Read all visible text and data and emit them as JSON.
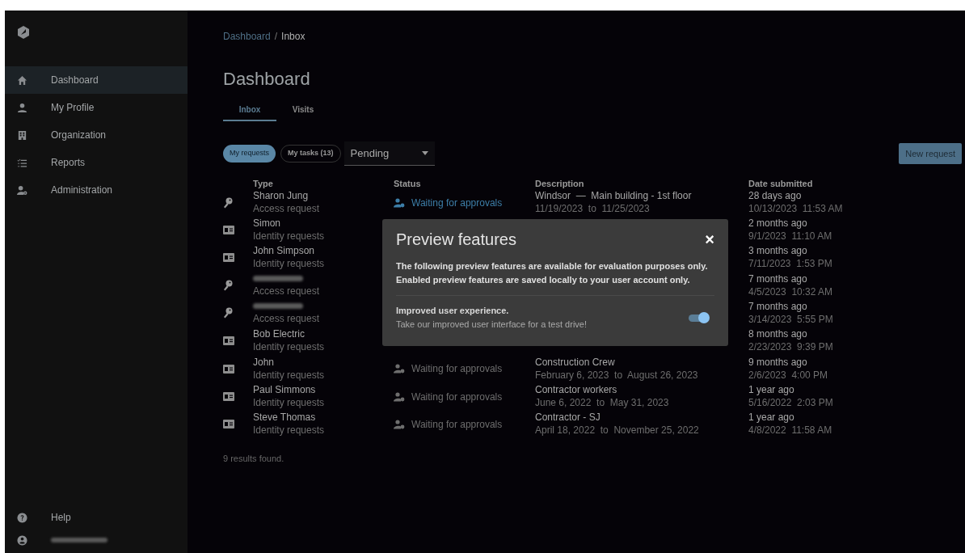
{
  "sidebar": {
    "items": [
      {
        "label": "Dashboard",
        "selected": true
      },
      {
        "label": "My Profile",
        "selected": false
      },
      {
        "label": "Organization",
        "selected": false
      },
      {
        "label": "Reports",
        "selected": false
      },
      {
        "label": "Administration",
        "selected": false
      }
    ],
    "bottom_items": [
      {
        "label": "Help"
      },
      {
        "redacted": true
      }
    ]
  },
  "breadcrumb": [
    {
      "label": "Dashboard",
      "link": true
    },
    {
      "label": "Inbox",
      "link": false
    }
  ],
  "breadcrumb_separator": "/",
  "title": "Dashboard",
  "tabs": [
    {
      "label": "Inbox",
      "selected": true
    },
    {
      "label": "Visits",
      "selected": false
    }
  ],
  "filters": [
    {
      "label": "My requests",
      "selected": true
    },
    {
      "label": "My tasks (13)",
      "selected": false
    }
  ],
  "status_select": {
    "value": "Pending"
  },
  "new_request_button": "New request",
  "table": {
    "columns": [
      "Type",
      "Status",
      "Description",
      "Date submitted"
    ],
    "rows": [
      {
        "kind": "key",
        "name": "Sharon Jung",
        "type": "Access request",
        "status": "Waiting for approvals",
        "highlighted": true,
        "description": "Windsor  —  Main building - 1st floor",
        "dates": "11/19/2023  to  11/25/2023",
        "ago": "28 days ago",
        "date": "10/13/2023  11:53 AM"
      },
      {
        "kind": "id-card",
        "name": "Simon",
        "type": "Identity requests",
        "ago": "2 months ago",
        "date": "9/1/2023  11:10 AM"
      },
      {
        "kind": "id-card",
        "name": "John Simpson",
        "type": "Identity requests",
        "ago": "3 months ago",
        "date": "7/11/2023  1:53 PM"
      },
      {
        "kind": "key",
        "redacted": true,
        "type": "Access request",
        "ago": "7 months ago",
        "date": "4/5/2023  10:32 AM"
      },
      {
        "kind": "key",
        "redacted": true,
        "type": "Access request",
        "ago": "7 months ago",
        "date": "3/14/2023  5:55 PM"
      },
      {
        "kind": "id-card",
        "name": "Bob Electric",
        "type": "Identity requests",
        "ago": "8 months ago",
        "date": "2/23/2023  9:39 PM"
      },
      {
        "kind": "id-card",
        "name": "John",
        "type": "Identity requests",
        "status": "Waiting for approvals",
        "highlighted": false,
        "description": "Construction Crew",
        "dates": "February 6, 2023  to  August 26, 2023",
        "ago": "9 months ago",
        "date": "2/6/2023  4:00 PM"
      },
      {
        "kind": "id-card",
        "name": "Paul Simmons",
        "type": "Identity requests",
        "status": "Waiting for approvals",
        "highlighted": false,
        "description": "Contractor workers",
        "dates": "June 6, 2022  to  May 31, 2023",
        "ago": "1 year ago",
        "date": "5/16/2022  2:03 PM"
      },
      {
        "kind": "id-card",
        "name": "Steve Thomas",
        "type": "Identity requests",
        "status": "Waiting for approvals",
        "highlighted": false,
        "description": "Contractor - SJ",
        "dates": "April 18, 2022  to  November 25, 2022",
        "ago": "1 year ago",
        "date": "4/8/2022  11:58 AM"
      }
    ]
  },
  "results": "9 results found.",
  "dialog": {
    "title": "Preview features",
    "close": "×",
    "text": [
      "The following preview features are available for evaluation purposes only.",
      "Enabled preview features are saved locally to your user account only."
    ],
    "features": [
      {
        "title": "Improved user experience.",
        "description": "Take our improved user interface for a test drive!",
        "on": true
      }
    ]
  }
}
